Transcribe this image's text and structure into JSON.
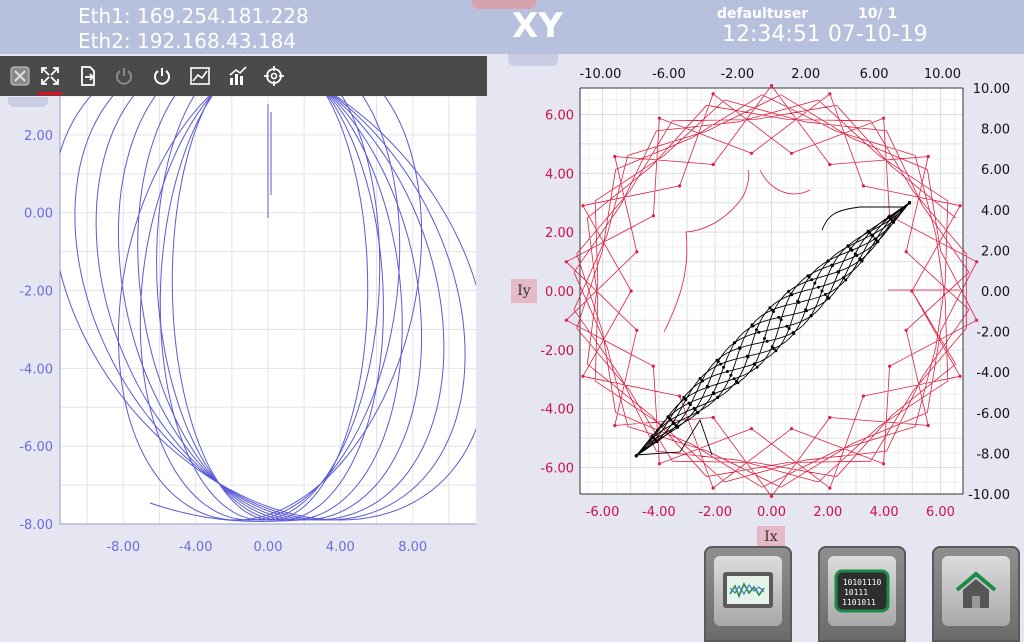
{
  "header": {
    "eth1": "Eth1: 169.254.181.228",
    "eth2": "Eth2: 192.168.43.184",
    "title": "XY",
    "user": "defaultuser",
    "page": "10/ 1",
    "time": "12:34:51",
    "date": "07-10-19"
  },
  "toolbar": {
    "items": [
      {
        "icon": "autoscale-icon"
      },
      {
        "icon": "fit-icon"
      },
      {
        "icon": "export-icon"
      },
      {
        "icon": "power-disabled-icon"
      },
      {
        "icon": "power-icon"
      },
      {
        "icon": "trend-icon"
      },
      {
        "icon": "chart-options-icon"
      },
      {
        "icon": "crosshair-icon"
      }
    ]
  },
  "colors": {
    "left_axis": "#6b6bde",
    "right_axis": "#cc1144",
    "red_trace": "#e02040",
    "black_trace": "#000000"
  },
  "chart_data": [
    {
      "type": "line",
      "name": "left-xy",
      "xlim": [
        -11.5,
        11.5
      ],
      "ylim": [
        -8.0,
        3.0
      ],
      "x_ticks": [
        -8,
        -4,
        0,
        4,
        8
      ],
      "x_tick_labels": [
        "-8.00",
        "-4.00",
        "0.00",
        "4.00",
        "8.00"
      ],
      "y_ticks": [
        2,
        0,
        -2,
        -4,
        -6,
        -8
      ],
      "y_tick_labels": [
        "2.00",
        "0.00",
        "-2.00",
        "-4.00",
        "-6.00",
        "-8.00"
      ],
      "grid": true
    },
    {
      "type": "line",
      "name": "right-xy",
      "xlabel": "Ix",
      "ylabel": "Iy",
      "xlim": [
        -6.8,
        6.8
      ],
      "ylim": [
        -6.9,
        6.9
      ],
      "x_ticks": [
        -6,
        -4,
        -2,
        0,
        2,
        4,
        6
      ],
      "x_tick_labels": [
        "-6.00",
        "-4.00",
        "-2.00",
        "0.00",
        "2.00",
        "4.00",
        "6.00"
      ],
      "y_ticks": [
        6,
        4,
        2,
        0,
        -2,
        -4,
        -6
      ],
      "y_tick_labels": [
        "6.00",
        "4.00",
        "2.00",
        "0.00",
        "-2.00",
        "-4.00",
        "-6.00"
      ],
      "top_x_ticks": [
        -10,
        -6,
        -2,
        2,
        6,
        10
      ],
      "top_x_tick_labels": [
        "-10.00",
        "-6.00",
        "-2.00",
        "2.00",
        "6.00",
        "10.00"
      ],
      "right_y_ticks": [
        10,
        8,
        6,
        4,
        2,
        0,
        -2,
        -4,
        -6,
        -8,
        -10
      ],
      "right_y_tick_labels": [
        "10.00",
        "8.00",
        "6.00",
        "4.00",
        "2.00",
        "0.00",
        "-2.00",
        "-4.00",
        "-6.00",
        "-8.00",
        "-10.00"
      ],
      "grid": true
    }
  ],
  "buttons": [
    {
      "icon": "trend-screen-icon"
    },
    {
      "icon": "binary-data-icon",
      "text": [
        "10101110",
        "10111",
        "1101011"
      ]
    },
    {
      "icon": "home-icon"
    }
  ]
}
